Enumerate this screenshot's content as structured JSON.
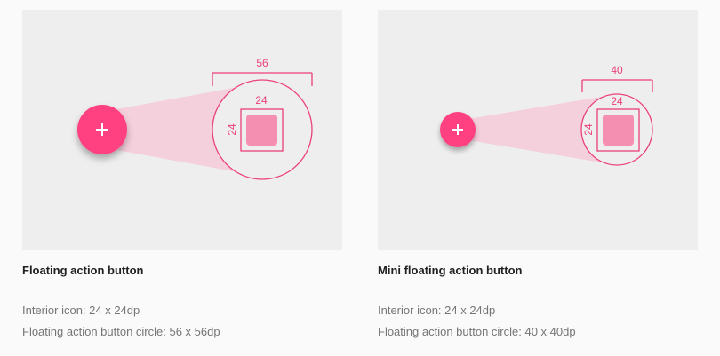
{
  "colors": {
    "accent": "#ff4081",
    "accent_stroke": "#ec407a",
    "cone_fill": "#f8bbd0",
    "icon_fill": "#f48fb1",
    "panel_bg": "#eeeeee",
    "page_bg": "#fafafa"
  },
  "fab": {
    "title": "Floating action button",
    "diagram": {
      "circle_size_label": "56",
      "icon_width_label": "24",
      "icon_height_label": "24",
      "button_icon": "plus-icon"
    },
    "details": [
      "Interior icon: 24 x 24dp",
      "Floating action button circle: 56 x 56dp"
    ]
  },
  "mini_fab": {
    "title": "Mini floating action button",
    "diagram": {
      "circle_size_label": "40",
      "icon_width_label": "24",
      "icon_height_label": "24",
      "button_icon": "plus-icon"
    },
    "details": [
      "Interior icon: 24 x 24dp",
      "Floating action button circle: 40 x 40dp"
    ]
  }
}
